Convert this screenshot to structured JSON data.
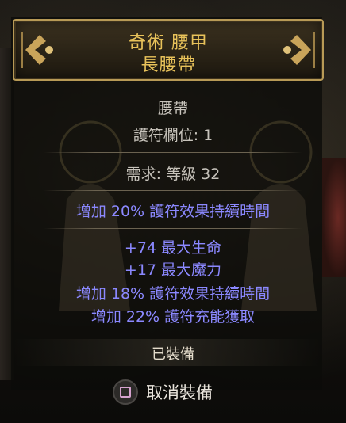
{
  "item": {
    "name_line1": "奇術 腰甲",
    "name_line2": "長腰帶",
    "item_class": "腰帶",
    "charm_slots": "護符欄位: 1",
    "requirement": "需求: 等級 32",
    "implicit_mod": "增加 20% 護符效果持續時間",
    "explicit_mods": [
      "+74 最大生命",
      "+17 最大魔力",
      "增加 18% 護符效果持續時間",
      "增加 22% 護符充能獲取"
    ],
    "status": "已裝備"
  },
  "action": {
    "button_icon": "square-button-icon",
    "unequip_label": "取消裝備"
  },
  "colors": {
    "title": "#e8c25a",
    "magic_mod": "#8b88ff",
    "frame": "#b89a56"
  }
}
